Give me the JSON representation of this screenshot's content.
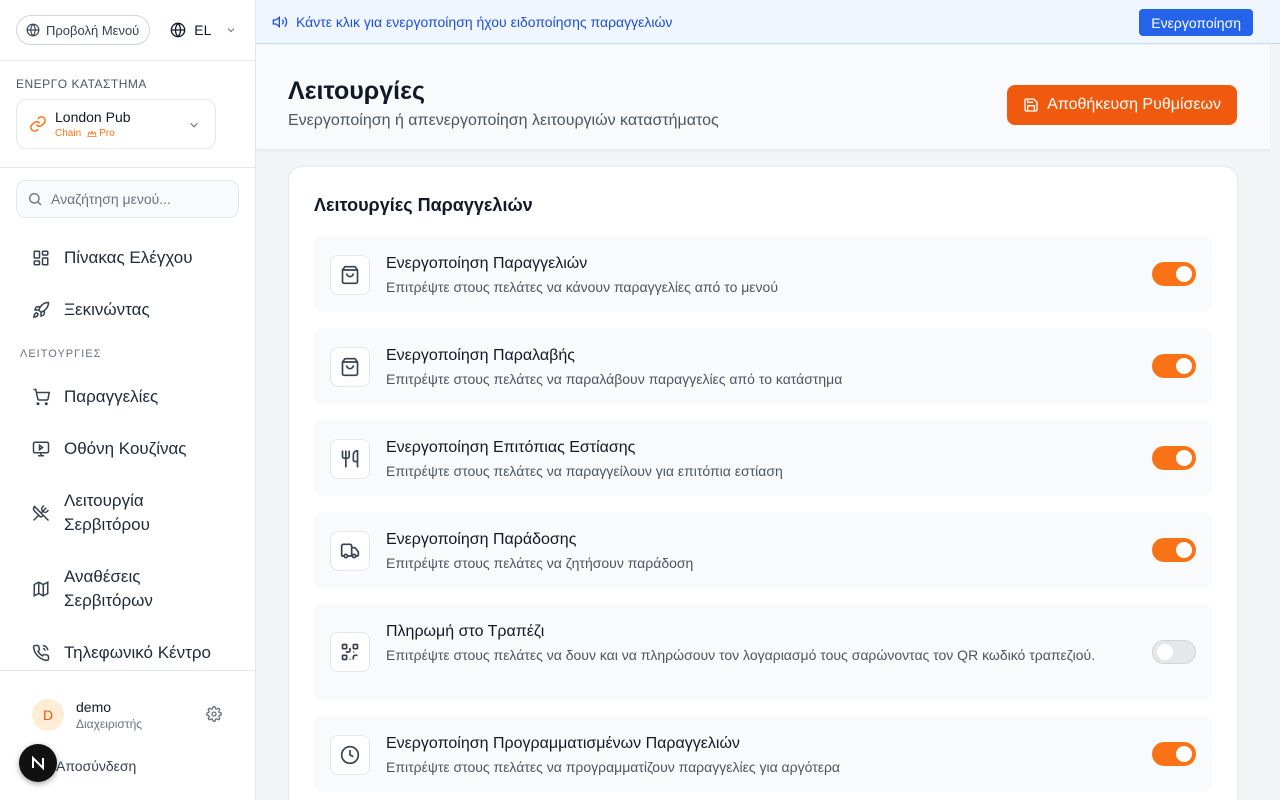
{
  "sidebar": {
    "menu_view_label": "Προβολή Μενού",
    "language": "EL",
    "active_store_caption": "ΕΝΕΡΓΟ ΚΑΤΑΣΤΗΜΑ",
    "store": {
      "name": "London Pub",
      "type": "Chain",
      "plan": "Pro"
    },
    "search_placeholder": "Αναζήτηση μενού...",
    "nav_top": [
      {
        "label": "Πίνακας Ελέγχου",
        "icon": "dashboard-icon"
      },
      {
        "label": "Ξεκινώντας",
        "icon": "rocket-icon"
      }
    ],
    "section_label": "ΛΕΙΤΟΥΡΓΙΕΣ",
    "nav_features": [
      {
        "label": "Παραγγελίες",
        "icon": "cart-icon"
      },
      {
        "label": "Οθόνη Κουζίνας",
        "icon": "monitor-icon"
      },
      {
        "label": "Λειτουργία Σερβιτόρου",
        "icon": "utensils-cross-icon"
      },
      {
        "label": "Αναθέσεις Σερβιτόρων",
        "icon": "map-icon"
      },
      {
        "label": "Τηλεφωνικό Κέντρο",
        "icon": "phone-icon"
      }
    ],
    "user": {
      "initial": "D",
      "name": "demo",
      "role": "Διαχειριστής"
    },
    "logout_label": "Αποσύνδεση",
    "badge_letter": "N"
  },
  "banner": {
    "text": "Κάντε κλικ για ενεργοποίηση ήχου ειδοποίησης παραγγελιών",
    "button_label": "Ενεργοποίηση",
    "color": "#2563eb"
  },
  "header": {
    "title": "Λειτουργίες",
    "subtitle": "Ενεργοποίηση ή απενεργοποίηση λειτουργιών καταστήματος",
    "save_label": "Αποθήκευση Ρυθμίσεων"
  },
  "accent_color": "#f97316",
  "card": {
    "title": "Λειτουργίες Παραγγελιών",
    "features": [
      {
        "title": "Ενεργοποίηση Παραγγελιών",
        "desc": "Επιτρέψτε στους πελάτες να κάνουν παραγγελίες από το μενού",
        "icon": "shopping-bag-icon",
        "enabled": true
      },
      {
        "title": "Ενεργοποίηση Παραλαβής",
        "desc": "Επιτρέψτε στους πελάτες να παραλάβουν παραγγελίες από το κατάστημα",
        "icon": "shopping-bag-icon",
        "enabled": true
      },
      {
        "title": "Ενεργοποίηση Επιτόπιας Εστίασης",
        "desc": "Επιτρέψτε στους πελάτες να παραγγείλουν για επιτόπια εστίαση",
        "icon": "utensils-icon",
        "enabled": true
      },
      {
        "title": "Ενεργοποίηση Παράδοσης",
        "desc": "Επιτρέψτε στους πελάτες να ζητήσουν παράδοση",
        "icon": "truck-icon",
        "enabled": true
      },
      {
        "title": "Πληρωμή στο Τραπέζι",
        "desc": "Επιτρέψτε στους πελάτες να δουν και να πληρώσουν τον λογαριασμό τους σαρώνοντας τον QR κωδικό τραπεζιού.",
        "icon": "qr-code-icon",
        "enabled": false
      },
      {
        "title": "Ενεργοποίηση Προγραμματισμένων Παραγγελιών",
        "desc": "Επιτρέψτε στους πελάτες να προγραμματίζουν παραγγελίες για αργότερα",
        "icon": "clock-icon",
        "enabled": true
      }
    ]
  }
}
